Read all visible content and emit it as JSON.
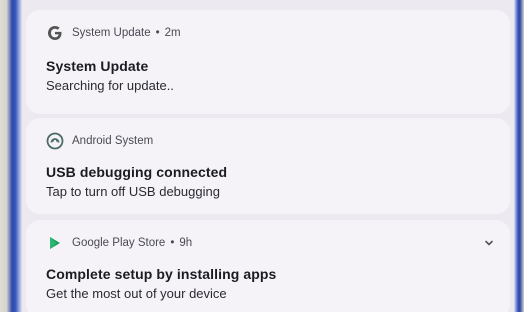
{
  "notifications": [
    {
      "app": "System Update",
      "time": "2m",
      "title": "System Update",
      "text": "Searching for update..",
      "icon": "google-g-icon"
    },
    {
      "app": "Android System",
      "time": "",
      "title": "USB debugging connected",
      "text": "Tap to turn off USB debugging",
      "icon": "android-system-icon"
    },
    {
      "app": "Google Play Store",
      "time": "9h",
      "title": "Complete setup by installing apps",
      "text": "Get the most out of your device",
      "icon": "play-store-icon"
    }
  ],
  "separator": "•",
  "colors": {
    "panel": "#ece9f0",
    "card": "#f5f3f7",
    "frame": "#3555c0",
    "play_green": "#1e9e57"
  }
}
